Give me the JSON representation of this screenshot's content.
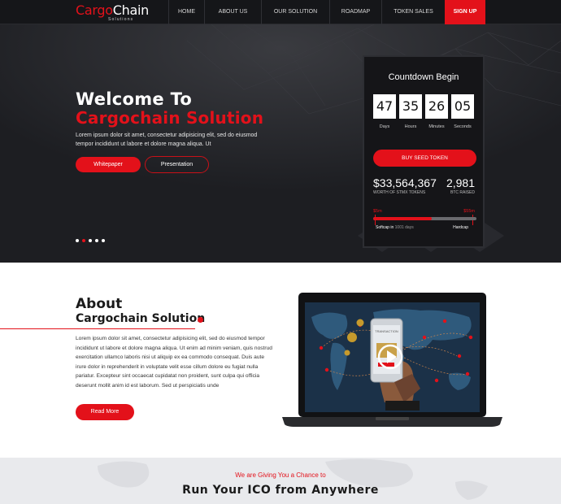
{
  "brand": {
    "part1": "Cargo",
    "part2": "Chain",
    "tagline": "Solutions"
  },
  "nav": {
    "items": [
      "HOME",
      "ABOUT US",
      "OUR SOLUTION",
      "ROADMAP",
      "TOKEN SALES"
    ],
    "signup": "SIGN UP"
  },
  "hero": {
    "title_line1": "Welcome To",
    "title_line2": "Cargochain Solution",
    "description": "Lorem ipsum dolor sit amet, consectetur adipisicing elit, sed do eiusmod tempor incididunt ut labore et dolore magna aliqua. Ut",
    "whitepaper_label": "Whitepaper",
    "presentation_label": "Presentation",
    "slides_total": 5,
    "slide_active": 2
  },
  "countdown": {
    "title": "Countdown Begin",
    "values": [
      "47",
      "35",
      "26",
      "05"
    ],
    "labels": [
      "Days",
      "Hours",
      "Minutes",
      "Seconds"
    ],
    "buy_label": "BUY SEED TOKEN",
    "amount": "$33,564,367",
    "amount_label": "WORTH OF STMX TOKENS",
    "btc": "2,981",
    "btc_label": "BTC RAISED",
    "progress_min": "$5m",
    "progress_max": "$55m",
    "progress_fraction": 0.57,
    "softcap_label": "Softcap in",
    "softcap_days": "1001 days",
    "hardcap_label": "Hardcap"
  },
  "about": {
    "heading": "About",
    "subheading": "Cargochain Solution",
    "text": "Lorem ipsum dolor sit amet, consectetur adipisicing elit, sed do eiusmod tempor incididunt ut labore et dolore magna aliqua. Ut enim ad minim veniam, quis nostrud exercitation ullamco laboris nisi ut aliquip ex ea commodo consequat. Duis aute irure dolor in reprehenderit in voluptate velit esse cillum dolore eu fugiat nulla pariatur. Excepteur sint occaecat cupidatat non proident, sunt culpa qui officia deserunt mollit anim id est laborum. Sed ut perspiciatis unde",
    "read_more": "Read More",
    "phone_screen_text": "TRANSACTION"
  },
  "ico": {
    "subtitle": "We are Giving You a Chance to",
    "title": "Run Your ICO from Anywhere"
  },
  "colors": {
    "accent": "#e3111a",
    "dark_bg": "#1d1e22",
    "nav_bg": "#151619",
    "light_section": "#e9eaed"
  }
}
